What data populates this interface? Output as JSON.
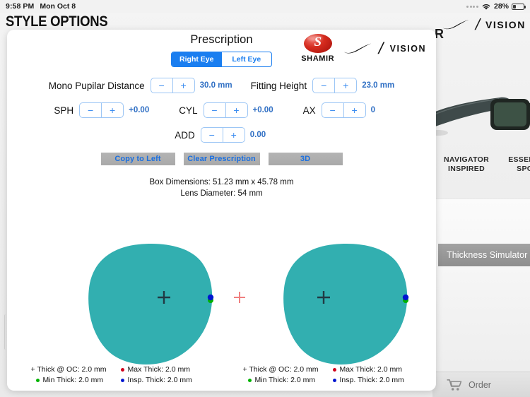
{
  "statusbar": {
    "time": "9:58 PM",
    "date": "Mon Oct 8",
    "battery_percent": "28%",
    "wifi_icon": "wifi-icon",
    "battery_icon": "battery-icon"
  },
  "background": {
    "app_title": "STYLE OPTIONS",
    "brand_vision": "VISION",
    "brand_slash": "/",
    "partial_word": "R",
    "products": [
      {
        "name_line1": "NAVIGATOR",
        "name_line2": "INSPIRED"
      },
      {
        "name_line1": "ESSENTIAL",
        "name_line2": "SPORT"
      }
    ],
    "thickness_simulator_tab": "Thickness Simulator",
    "order_label": "Order",
    "cart_icon": "shopping-cart-icon"
  },
  "panel": {
    "title": "Prescription",
    "logos": {
      "shamir_wordmark": "SHAMIR",
      "nike_swoosh": "nike-swoosh-icon",
      "slash": "/",
      "vision": "VISION"
    },
    "eye_selector": {
      "options": [
        {
          "label": "Right Eye",
          "selected": true
        },
        {
          "label": "Left Eye",
          "selected": false
        }
      ]
    },
    "fields": {
      "mono_pd": {
        "label": "Mono Pupilar Distance",
        "value": "30.0 mm",
        "minus": "−",
        "plus": "+"
      },
      "fitting_height": {
        "label": "Fitting Height",
        "value": "23.0 mm",
        "minus": "−",
        "plus": "+"
      },
      "sph": {
        "label": "SPH",
        "value": "+0.00",
        "minus": "−",
        "plus": "+"
      },
      "cyl": {
        "label": "CYL",
        "value": "+0.00",
        "minus": "−",
        "plus": "+"
      },
      "ax": {
        "label": "AX",
        "value": "0",
        "minus": "−",
        "plus": "+"
      },
      "add": {
        "label": "ADD",
        "value": "0.00",
        "minus": "−",
        "plus": "+"
      }
    },
    "buttons": {
      "copy_to_left": "Copy to Left",
      "clear_prescription": "Clear Prescription",
      "three_d": "3D"
    },
    "dimensions": {
      "box": "Box Dimensions: 51.23 mm x 45.78 mm",
      "lens_diameter": "Lens Diameter:  54 mm"
    },
    "lens_preview": {
      "lens_color": "#32afb0",
      "oc_marker_color": "#213a44",
      "center_cross_color": "#f08080",
      "max_thick_color": "#d0021b",
      "min_thick_color": "#00b200",
      "insp_thick_color": "#0016d0"
    },
    "legend": {
      "right": {
        "thick_oc": "+ Thick @ OC: 2.0 mm",
        "max_thick": "Max Thick: 2.0 mm",
        "min_thick": "Min Thick: 2.0 mm",
        "insp_thick": "Insp. Thick: 2.0 mm"
      },
      "left": {
        "thick_oc": "+ Thick @ OC: 2.0 mm",
        "max_thick": "Max Thick: 2.0 mm",
        "min_thick": "Min Thick: 2.0 mm",
        "insp_thick": "Insp. Thick: 2.0 mm"
      }
    }
  },
  "colors": {
    "accent_blue": "#1a7ef0",
    "value_blue": "#2f6fc4",
    "teal": "#32afb0",
    "button_gray": "#ababab"
  }
}
